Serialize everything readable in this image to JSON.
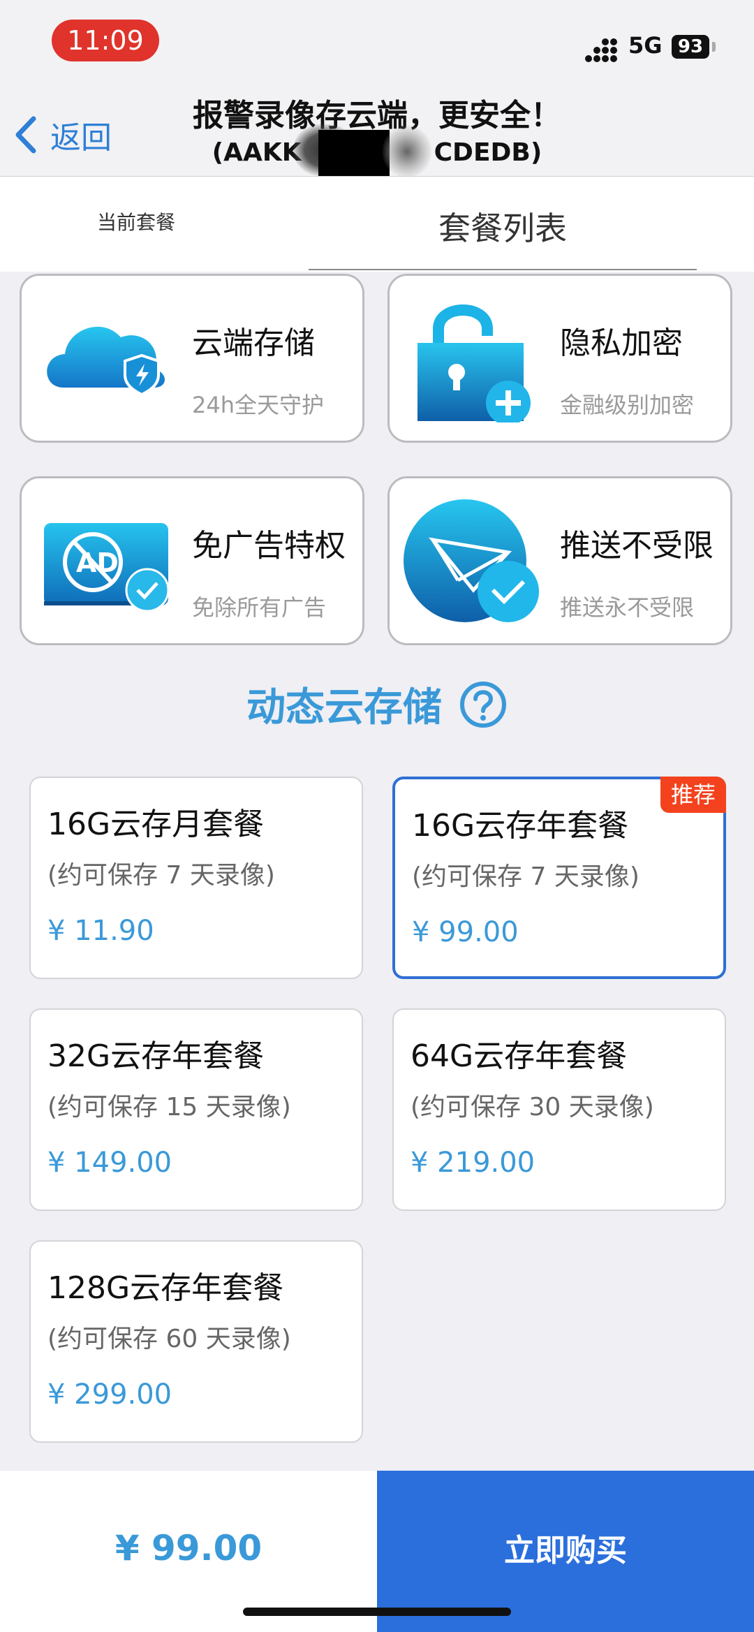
{
  "status_bar": {
    "time": "11:09",
    "network": "5G",
    "battery": "93"
  },
  "nav": {
    "back_label": "返回",
    "title": "报警录像存云端，更安全！",
    "subtitle_left": "(AAKK",
    "subtitle_right": "CDEDB)"
  },
  "tabs": {
    "current": "当前套餐",
    "list": "套餐列表"
  },
  "features": [
    {
      "title": "云端存储",
      "subtitle": "24h全天守护",
      "icon": "cloud-shield-icon"
    },
    {
      "title": "隐私加密",
      "subtitle": "金融级别加密",
      "icon": "lock-plus-icon"
    },
    {
      "title": "免广告特权",
      "subtitle": "免除所有广告",
      "icon": "no-ad-icon"
    },
    {
      "title": "推送不受限",
      "subtitle": "推送永不受限",
      "icon": "paper-plane-icon"
    }
  ],
  "section": {
    "title": "动态云存储",
    "help_icon": "question-circle-icon"
  },
  "packages": [
    {
      "name": "16G云存月套餐",
      "note": "(约可保存 7 天录像)",
      "price": "¥ 11.90"
    },
    {
      "name": "16G云存年套餐",
      "note": "(约可保存 7 天录像)",
      "price": "¥ 99.00",
      "badge": "推荐",
      "selected": true
    },
    {
      "name": "32G云存年套餐",
      "note": "(约可保存 15 天录像)",
      "price": "¥ 149.00"
    },
    {
      "name": "64G云存年套餐",
      "note": "(约可保存 30 天录像)",
      "price": "¥ 219.00"
    },
    {
      "name": "128G云存年套餐",
      "note": "(约可保存 60 天录像)",
      "price": "¥ 299.00"
    }
  ],
  "bottom": {
    "total": "¥ 99.00",
    "buy_label": "立即购买"
  },
  "colors": {
    "accent": "#2b6fdc",
    "price": "#3a99d8",
    "badge": "#f3421d",
    "time_pill": "#e0332b"
  }
}
